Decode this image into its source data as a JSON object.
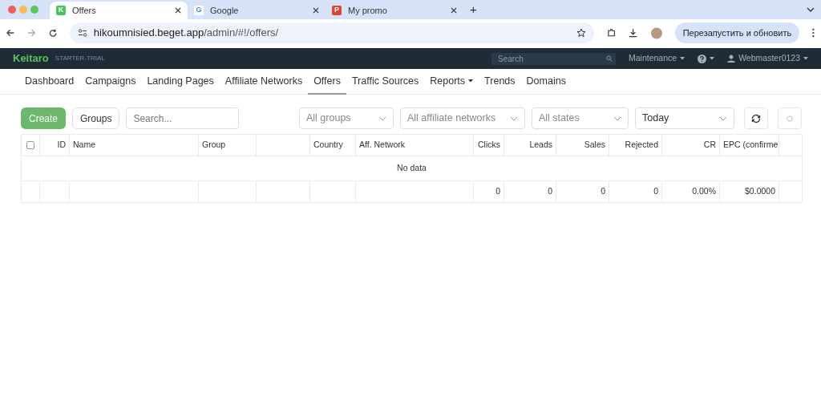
{
  "browser": {
    "tabs": [
      {
        "title": "Offers",
        "selected": true,
        "favicon": "K"
      },
      {
        "title": "Google",
        "selected": false,
        "favicon": "G"
      },
      {
        "title": "My promo",
        "selected": false,
        "favicon": "P"
      }
    ],
    "new_tab": "+",
    "url_host": "hikoumnisied.beget.app",
    "url_path": "/admin/#!/offers/",
    "update_button": "Перезапустить и обновить"
  },
  "app": {
    "logo": "Keitaro",
    "edition": "STARTER-TRIAL",
    "search_placeholder": "Search",
    "maintenance": "Maintenance",
    "user": "Webmaster0123",
    "menu": [
      {
        "label": "Dashboard",
        "selected": false,
        "dropdown": false
      },
      {
        "label": "Campaigns",
        "selected": false,
        "dropdown": false
      },
      {
        "label": "Landing Pages",
        "selected": false,
        "dropdown": false
      },
      {
        "label": "Affiliate Networks",
        "selected": false,
        "dropdown": false
      },
      {
        "label": "Offers",
        "selected": true,
        "dropdown": false
      },
      {
        "label": "Traffic Sources",
        "selected": false,
        "dropdown": false
      },
      {
        "label": "Reports",
        "selected": false,
        "dropdown": true
      },
      {
        "label": "Trends",
        "selected": false,
        "dropdown": false
      },
      {
        "label": "Domains",
        "selected": false,
        "dropdown": false
      }
    ]
  },
  "toolbar": {
    "create": "Create",
    "groups": "Groups",
    "search_placeholder": "Search...",
    "filters": [
      {
        "placeholder": "All groups"
      },
      {
        "placeholder": "All affiliate networks"
      },
      {
        "placeholder": "All states"
      },
      {
        "value": "Today"
      }
    ]
  },
  "table": {
    "select_all_checked": false,
    "columns": [
      {
        "label": "ID",
        "kind": "number"
      },
      {
        "label": "Name",
        "kind": "text"
      },
      {
        "label": "Group",
        "kind": "text"
      },
      {
        "kind": "text"
      },
      {
        "label": "Country",
        "kind": "text"
      },
      {
        "label": "Aff. Network",
        "kind": "text"
      },
      {
        "label": "Clicks",
        "kind": "number",
        "total": "0"
      },
      {
        "label": "Leads",
        "kind": "number",
        "total": "0"
      },
      {
        "label": "Sales",
        "kind": "number",
        "total": "0"
      },
      {
        "label": "Rejected",
        "kind": "number",
        "total": "0"
      },
      {
        "label": "CR",
        "kind": "number",
        "total": "0.00%"
      },
      {
        "label": "EPC (confirme",
        "kind": "text",
        "total": "$0.0000"
      },
      {
        "kind": "text"
      }
    ],
    "empty_message": "No data"
  }
}
